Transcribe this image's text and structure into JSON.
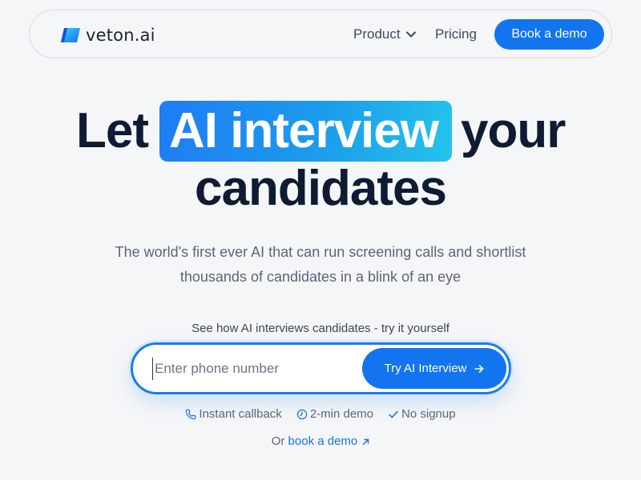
{
  "nav": {
    "logo_text": "veton.ai",
    "product_label": "Product",
    "pricing_label": "Pricing",
    "demo_button": "Book a demo"
  },
  "hero": {
    "line1_pre": "Let",
    "line1_highlight": "AI interview",
    "line1_post": "your",
    "line2": "candidates",
    "subtitle": "The world's first ever AI that can run screening calls and shortlist thousands of candidates in a blink of an eye"
  },
  "cta": {
    "caption": "See how AI interviews candidates - try it yourself",
    "phone_placeholder": "Enter phone number",
    "phone_value": "",
    "try_button": "Try AI Interview"
  },
  "features": [
    {
      "label": "Instant callback",
      "icon": "phone-icon"
    },
    {
      "label": "2-min demo",
      "icon": "clock-icon"
    },
    {
      "label": "No signup",
      "icon": "check-icon"
    }
  ],
  "footer": {
    "or_text": "Or",
    "demo_link": "book a demo"
  },
  "colors": {
    "accent": "#1374ef",
    "heading": "#0f1b33",
    "highlight_start": "#1f7cf5",
    "highlight_end": "#25c3ec",
    "background": "#f5f6f8"
  }
}
